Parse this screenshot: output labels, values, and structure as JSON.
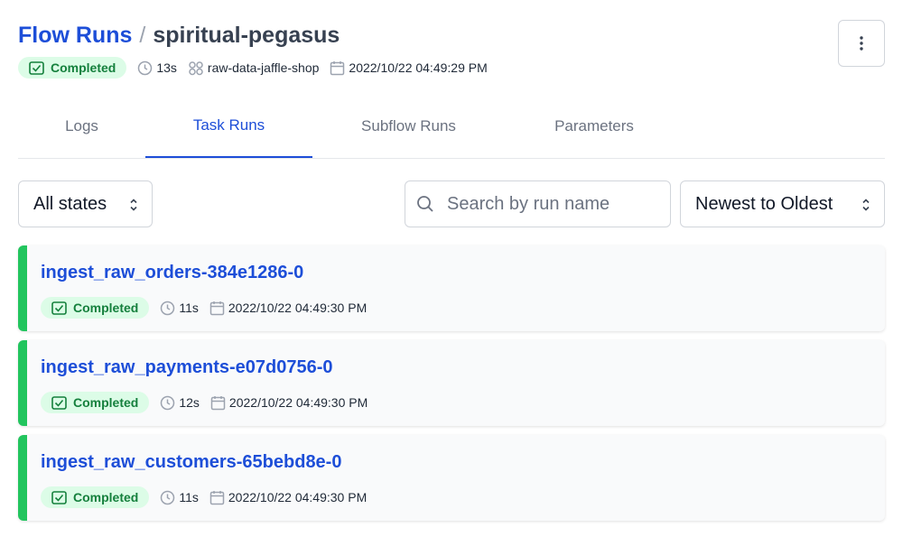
{
  "header": {
    "breadcrumb_root": "Flow Runs",
    "breadcrumb_sep": "/",
    "run_name": "spiritual-pegasus",
    "state": "Completed",
    "duration": "13s",
    "deployment": "raw-data-jaffle-shop",
    "start_time": "2022/10/22 04:49:29 PM"
  },
  "tabs": [
    "Logs",
    "Task Runs",
    "Subflow Runs",
    "Parameters"
  ],
  "active_tab": "Task Runs",
  "filters": {
    "state_filter": "All states",
    "search_placeholder": "Search by run name",
    "sort": "Newest to Oldest"
  },
  "task_runs": [
    {
      "name": "ingest_raw_orders-384e1286-0",
      "state": "Completed",
      "duration": "11s",
      "start_time": "2022/10/22 04:49:30 PM"
    },
    {
      "name": "ingest_raw_payments-e07d0756-0",
      "state": "Completed",
      "duration": "12s",
      "start_time": "2022/10/22 04:49:30 PM"
    },
    {
      "name": "ingest_raw_customers-65bebd8e-0",
      "state": "Completed",
      "duration": "11s",
      "start_time": "2022/10/22 04:49:30 PM"
    }
  ],
  "colors": {
    "accent": "#1d4ed8",
    "completed_bg": "#dcfce7",
    "completed_text": "#15803d",
    "completed_bar": "#22c55e"
  }
}
